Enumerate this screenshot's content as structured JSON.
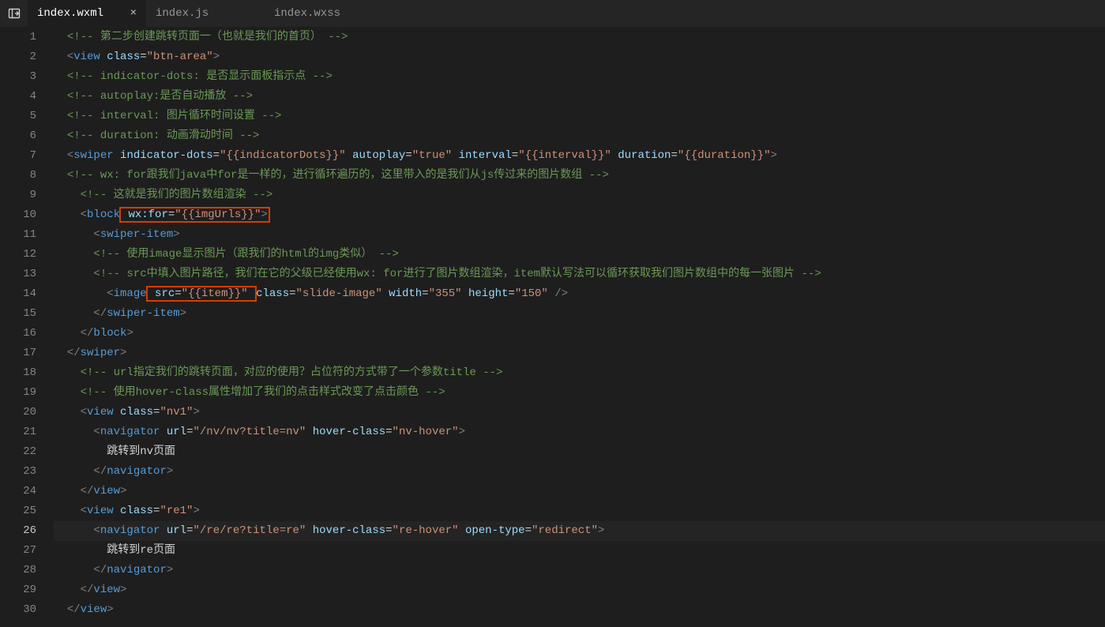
{
  "tabs": {
    "panel_icon": "panel-toggle",
    "items": [
      {
        "label": "index.wxml",
        "active": true
      },
      {
        "label": "index.js",
        "active": false
      },
      {
        "label": "index.wxss",
        "active": false
      }
    ],
    "close_glyph": "×"
  },
  "gutter": {
    "start": 1,
    "end": 30
  },
  "code": {
    "l1": {
      "pre": "  ",
      "open": "<!--",
      "text": " 第二步创建跳转页面一（也就是我们的首页） ",
      "close": "-->"
    },
    "l2": {
      "pre": "  ",
      "lt": "<",
      "tag": "view",
      "sp": " ",
      "attr": "class",
      "eq": "=",
      "val": "\"btn-area\"",
      "gt": ">"
    },
    "l3": {
      "pre": "  ",
      "open": "<!--",
      "text": " indicator-dots: 是否显示面板指示点 ",
      "close": "-->"
    },
    "l4": {
      "pre": "  ",
      "open": "<!--",
      "text": " autoplay:是否自动播放 ",
      "close": "-->"
    },
    "l5": {
      "pre": "  ",
      "open": "<!--",
      "text": " interval: 图片循环时间设置 ",
      "close": "-->"
    },
    "l6": {
      "pre": "  ",
      "open": "<!--",
      "text": " duration: 动画滑动时间 ",
      "close": "-->"
    },
    "l7": {
      "pre": "  ",
      "lt": "<",
      "tag": "swiper",
      "sp": " ",
      "a1n": "indicator-dots",
      "a1e": "=",
      "a1v": "\"{{indicatorDots}}\"",
      "sp1": " ",
      "a2n": "autoplay",
      "a2e": "=",
      "a2v": "\"true\"",
      "sp2": " ",
      "a3n": "interval",
      "a3e": "=",
      "a3v": "\"{{interval}}\"",
      "sp3": " ",
      "a4n": "duration",
      "a4e": "=",
      "a4v": "\"{{duration}}\"",
      "gt": ">"
    },
    "l8": {
      "pre": "  ",
      "open": "<!--",
      "text": " wx: for跟我们java中for是一样的，进行循环遍历的，这里带入的是我们从js传过来的图片数组 ",
      "close": "-->"
    },
    "l9": {
      "pre": "    ",
      "open": "<!--",
      "text": " 这就是我们的图片数组渲染 ",
      "close": "-->"
    },
    "l10": {
      "pre": "    ",
      "lt": "<",
      "tag": "block",
      "sp": " ",
      "a1n": "wx:for",
      "a1e": "=",
      "a1v": "\"{{imgUrls}}\"",
      "gt": ">"
    },
    "l11": {
      "pre": "      ",
      "lt": "<",
      "tag": "swiper-item",
      "gt": ">"
    },
    "l12": {
      "pre": "      ",
      "open": "<!--",
      "text": " 使用image显示图片（跟我们的html的img类似） ",
      "close": "-->"
    },
    "l13": {
      "pre": "      ",
      "open": "<!--",
      "text": " src中填入图片路径，我们在它的父级已经使用wx: for进行了图片数组渲染，item默认写法可以循环获取我们图片数组中的每一张图片 ",
      "close": "-->"
    },
    "l14": {
      "pre": "        ",
      "lt": "<",
      "tag": "image",
      "sp": " ",
      "a1n": "src",
      "a1e": "=",
      "a1v": "\"{{item}}\"",
      "sp1": " ",
      "a2n": "class",
      "a2e": "=",
      "a2v": "\"slide-image\"",
      "sp2": " ",
      "a3n": "width",
      "a3e": "=",
      "a3v": "\"355\"",
      "sp3": " ",
      "a4n": "height",
      "a4e": "=",
      "a4v": "\"150\"",
      "sp4": " ",
      "slash": "/",
      "gt": ">"
    },
    "l15": {
      "pre": "      ",
      "lt": "</",
      "tag": "swiper-item",
      "gt": ">"
    },
    "l16": {
      "pre": "    ",
      "lt": "</",
      "tag": "block",
      "gt": ">"
    },
    "l17": {
      "pre": "  ",
      "lt": "</",
      "tag": "swiper",
      "gt": ">"
    },
    "l18": {
      "pre": "    ",
      "open": "<!--",
      "text": " url指定我们的跳转页面，对应的使用？占位符的方式带了一个参数title ",
      "close": "-->"
    },
    "l19": {
      "pre": "    ",
      "open": "<!--",
      "text": " 使用hover-class属性增加了我们的点击样式改变了点击颜色 ",
      "close": "-->"
    },
    "l20": {
      "pre": "    ",
      "lt": "<",
      "tag": "view",
      "sp": " ",
      "a1n": "class",
      "a1e": "=",
      "a1v": "\"nv1\"",
      "gt": ">"
    },
    "l21": {
      "pre": "      ",
      "lt": "<",
      "tag": "navigator",
      "sp": " ",
      "a1n": "url",
      "a1e": "=",
      "a1v": "\"/nv/nv?title=nv\"",
      "sp1": " ",
      "a2n": "hover-class",
      "a2e": "=",
      "a2v": "\"nv-hover\"",
      "gt": ">"
    },
    "l22": {
      "pre": "        ",
      "text": "跳转到nv页面"
    },
    "l23": {
      "pre": "      ",
      "lt": "</",
      "tag": "navigator",
      "gt": ">"
    },
    "l24": {
      "pre": "    ",
      "lt": "</",
      "tag": "view",
      "gt": ">"
    },
    "l25": {
      "pre": "    ",
      "lt": "<",
      "tag": "view",
      "sp": " ",
      "a1n": "class",
      "a1e": "=",
      "a1v": "\"re1\"",
      "gt": ">"
    },
    "l26": {
      "pre": "      ",
      "lt": "<",
      "tag": "navigator",
      "sp": " ",
      "a1n": "url",
      "a1e": "=",
      "a1v": "\"/re/re?title=re\"",
      "sp1": " ",
      "a2n": "hover-class",
      "a2e": "=",
      "a2v": "\"re-hover\"",
      "sp2": " ",
      "a3n": "open-type",
      "a3e": "=",
      "a3v": "\"redirect\"",
      "gt": ">"
    },
    "l27": {
      "pre": "        ",
      "text": "跳转到re页面"
    },
    "l28": {
      "pre": "      ",
      "lt": "</",
      "tag": "navigator",
      "gt": ">"
    },
    "l29": {
      "pre": "    ",
      "lt": "</",
      "tag": "view",
      "gt": ">"
    },
    "l30": {
      "pre": "  ",
      "lt": "</",
      "tag": "view",
      "gt": ">"
    }
  }
}
